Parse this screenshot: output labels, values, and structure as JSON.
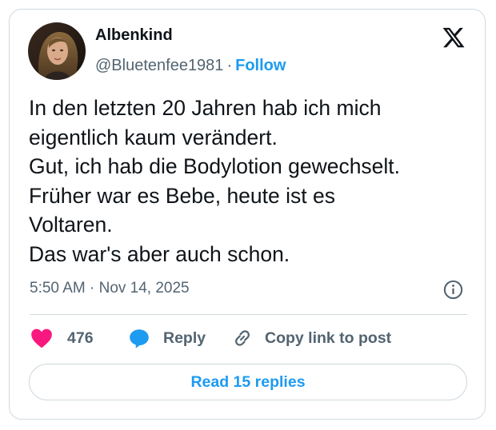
{
  "tweet": {
    "author_name": "Albenkind",
    "handle": "@Bluetenfee1981",
    "separator": "·",
    "follow_label": "Follow",
    "text_lines": [
      "In den letzten 20 Jahren hab ich mich",
      "eigentlich kaum verändert.",
      "Gut, ich hab die Bodylotion gewechselt.",
      "Früher war es Bebe, heute ist es",
      "Voltaren.",
      "Das war's aber auch schon."
    ],
    "timestamp": "5:50 AM · Nov 14, 2025",
    "like_count": "476",
    "reply_label": "Reply",
    "copy_link_label": "Copy link to post",
    "read_replies_label": "Read 15 replies"
  },
  "icons": {
    "logo": "x-logo-icon",
    "info": "info-icon",
    "like": "heart-icon",
    "reply": "speech-bubble-icon",
    "copy": "link-icon"
  },
  "colors": {
    "accent": "#1d9bf0",
    "like": "#f91880",
    "text_primary": "#0f1419",
    "text_secondary": "#536471",
    "border": "#cfd9de"
  }
}
